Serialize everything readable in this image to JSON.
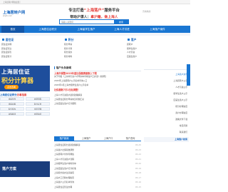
{
  "topbar": {
    "notice": "上海居转户网欢迎您！"
  },
  "header": {
    "logo_text": "上海居转户网",
    "logo_sub": "shjzh.com",
    "slogan_line1_pre": "专注打造",
    "slogan_line1_hl": "“上海落户”",
    "slogan_line1_post": "服务平台",
    "slogan_line2_pre": "帮助沪漂人：",
    "slogan_line2_hl": "拿沪籍，做上海人",
    "search_placeholder": "请输入关键词",
    "search_button": "搜索",
    "hotline": "咨询热线"
  },
  "nav": {
    "items": [
      {
        "label": "首页"
      },
      {
        "label": "上海居住证积分"
      },
      {
        "label": "上海留学生落户"
      },
      {
        "label": "上海人才引进"
      },
      {
        "label": "上海落户案件"
      }
    ]
  },
  "categories": [
    {
      "title": "居住证",
      "links": [
        "居住证办理",
        "居住证签注",
        "居住证续签",
        "居住证积分"
      ]
    },
    {
      "title": "积分",
      "links": [
        "积分申请",
        "积分计算",
        "积分续办",
        "积分材料"
      ]
    },
    {
      "title": "落户",
      "links": [
        "居转户",
        "留学生落户",
        "人才引进",
        "应届生落户"
      ]
    }
  ],
  "left": {
    "banner_line1": "上海居住证",
    "banner_line2": "积分计算器",
    "banner_button": "点击查看",
    "heading_pre": "上海居住证积分",
    "heading_hl": "办事指南",
    "chips": [
      "申请条件",
      "办理流程",
      "申请材料",
      "积分标准",
      "积分续办",
      "常见问题",
      "政策解读",
      "办理进度"
    ],
    "bottom_banner": "落户方案"
  },
  "main": {
    "panel_title": "落户头条新闻",
    "head_news": "上海市调整2025年度社保缴费基数上下限",
    "news": [
      {
        "text": "关于印发《上海市引进人才申办本市常住户口办法》的通知",
        "red": false
      },
      {
        "text": "2025年上海居转户公示名单查询入口",
        "red": false
      },
      {
        "text": "2025年4月上海市留学生落户公示名单",
        "red": false
      },
      {
        "text": "社保基数7月1日起调整！",
        "red": true
      },
      {
        "text": "上海人才引进落户最新政策解读",
        "red": false
      },
      {
        "text": "上海居住证积分申请常见问题汇总",
        "red": false
      },
      {
        "text": "上海应届生落户打分细则",
        "red": false
      }
    ],
    "tabs": [
      {
        "label": "落户新闻"
      },
      {
        "label": "上海落户"
      },
      {
        "label": "上海户口"
      },
      {
        "label": "落户咨询"
      }
    ],
    "list": [
      {
        "text": "上海居住证积分最新政策解读",
        "date": "05-25"
      },
      {
        "text": "上海落户社保基数调整",
        "date": "05-23"
      },
      {
        "text": "上海居转户条件有哪些",
        "date": "05-22"
      },
      {
        "text": "上海人才引进落户流程",
        "date": "05-21"
      },
      {
        "text": "上海留学生落户材料清单",
        "date": "05-20"
      },
      {
        "text": "上海应届生落户打分标准",
        "date": "05-19"
      },
      {
        "text": "上海积分续办注意事项",
        "date": "05-18"
      },
      {
        "text": "上海户口迁移办理指南",
        "date": "05-17"
      },
      {
        "text": "上海落户公示名单查询",
        "date": "05-16"
      },
      {
        "text": "上海居住证签注办理",
        "date": "05-15"
      }
    ]
  },
  "right": {
    "links": [
      {
        "text": "上海落户资讯",
        "blue": true
      },
      {
        "text": "上海居转户公示",
        "blue": false
      },
      {
        "text": "人才引进公示",
        "blue": false
      },
      {
        "text": "留学生落户公示",
        "blue": false
      },
      {
        "text": "应届生落户公示",
        "blue": false
      },
      {
        "text": "积分办理进度",
        "blue": false
      },
      {
        "text": "落户办理进度",
        "blue": false
      },
      {
        "text": "政策文件下载",
        "blue": false
      },
      {
        "text": "常见问题",
        "blue": false
      },
      {
        "text": "联系我们",
        "blue": false
      }
    ],
    "box_title": "上海落户政策"
  },
  "colors": {
    "brand": "#1976d2",
    "highlight": "#e53935"
  }
}
